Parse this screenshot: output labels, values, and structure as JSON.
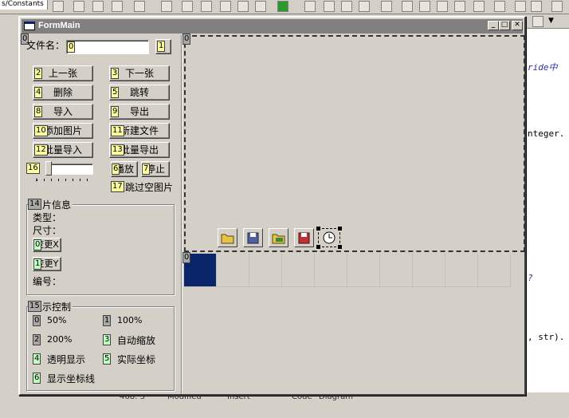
{
  "ide": {
    "tab_label": "s/Constants",
    "code_lines": [
      "ride中",
      "nteger.",
      "?",
      ", str)."
    ],
    "status": [
      "468:  3",
      "Modified",
      "Insert",
      "Code",
      "Diagram"
    ]
  },
  "window": {
    "title": "FormMain",
    "minimize": "_",
    "maximize": "□",
    "close": "✕"
  },
  "file": {
    "label": "文件名：",
    "input_tag": "0",
    "browse_tag": "1",
    "browse_label": ""
  },
  "panel_tag": "0",
  "buttons": [
    {
      "tag": "2",
      "label": "上一张"
    },
    {
      "tag": "3",
      "label": "下一张"
    },
    {
      "tag": "4",
      "label": "删除"
    },
    {
      "tag": "5",
      "label": "跳转"
    },
    {
      "tag": "8",
      "label": "导入"
    },
    {
      "tag": "9",
      "label": "导出"
    },
    {
      "tag": "10",
      "label": "添加图片"
    },
    {
      "tag": "11",
      "label": "新建文件"
    },
    {
      "tag": "12",
      "label": "批量导入"
    },
    {
      "tag": "13",
      "label": "批量导出"
    }
  ],
  "playback": {
    "slider_tag": "16",
    "play_tag": "6",
    "play_label": "播放",
    "stop_tag": "7",
    "stop_label": "停止",
    "skip_tag": "17",
    "skip_label": "跳过空图片"
  },
  "info": {
    "tag": "14",
    "title": "图片信息",
    "type_label": "类型：",
    "size_label": "尺寸：",
    "change_x_tag": "0",
    "change_x_label": "变更X",
    "change_y_tag": "1",
    "change_y_label": "变更Y",
    "id_label": "编号："
  },
  "display": {
    "tag": "15",
    "title": "显示控制",
    "options": [
      {
        "tag": "0",
        "label": "50%"
      },
      {
        "tag": "1",
        "label": "100%"
      },
      {
        "tag": "2",
        "label": "200%"
      },
      {
        "tag": "3",
        "label": "自动缩放"
      },
      {
        "tag": "4",
        "label": "透明显示"
      },
      {
        "tag": "5",
        "label": "实际坐标"
      },
      {
        "tag": "6",
        "label": "显示坐标线"
      }
    ]
  },
  "grid": {
    "tag": "0"
  }
}
